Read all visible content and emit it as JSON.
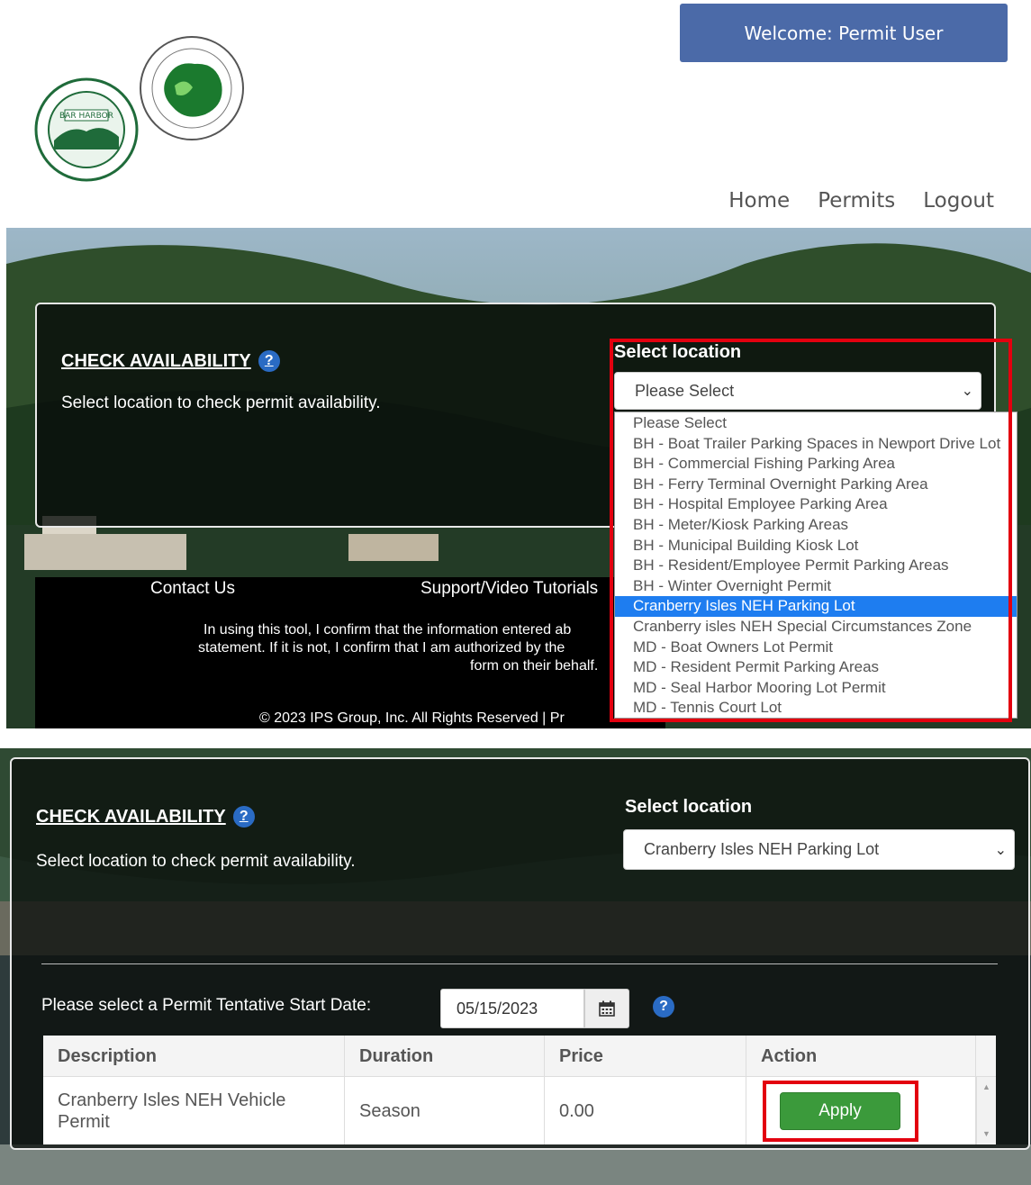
{
  "header": {
    "welcome": "Welcome:  Permit User",
    "nav": [
      "Home",
      "Permits",
      "Logout"
    ]
  },
  "seals": {
    "bar_harbor": "BAR HARBOR seal",
    "mount_desert": "TOWN OF MOUNT DESERT seal"
  },
  "check": {
    "title": "CHECK AVAILABILITY",
    "help": "?",
    "subtitle": "Select location to check permit availability.",
    "location_label": "Select location"
  },
  "dropdown": {
    "current": "Please Select",
    "options": [
      "Please Select",
      "BH - Boat Trailer Parking Spaces in Newport Drive Lot",
      "BH - Commercial Fishing Parking Area",
      "BH - Ferry Terminal Overnight Parking Area",
      "BH - Hospital Employee Parking Area",
      "BH - Meter/Kiosk Parking Areas",
      "BH - Municipal Building Kiosk Lot",
      "BH - Resident/Employee Permit Parking Areas",
      "BH - Winter Overnight Permit",
      "Cranberry Isles NEH Parking Lot",
      "Cranberry isles NEH Special Circumstances Zone",
      "MD - Boat Owners Lot Permit",
      "MD - Resident Permit Parking Areas",
      "MD - Seal Harbor Mooring Lot Permit",
      "MD - Tennis Court Lot"
    ],
    "highlighted": "Cranberry Isles NEH Parking Lot"
  },
  "footer": {
    "contact": "Contact Us",
    "support": "Support/Video Tutorials",
    "disclaimer_line1": "In using this tool, I confirm that the information entered ab",
    "disclaimer_line2": "statement. If it is not, I confirm that I am authorized by the",
    "disclaimer_line3": "form on their behalf.",
    "copyright": "© 2023 IPS Group, Inc. All Rights Reserved  |  Pr"
  },
  "second": {
    "selected_location": "Cranberry Isles NEH Parking Lot",
    "date_label": "Please select a Permit Tentative Start Date:",
    "date_value": "05/15/2023",
    "table": {
      "headers": [
        "Description",
        "Duration",
        "Price",
        "Action"
      ],
      "rows": [
        {
          "description_1": "Cranberry Isles NEH Vehicle",
          "description_2": "Permit",
          "duration": "Season",
          "price": "0.00",
          "action": "Apply"
        }
      ]
    }
  },
  "colors": {
    "welcome_bg": "#4b6aa8",
    "highlight": "#1e7df0",
    "apply": "#3b9a3b",
    "annotation": "#e3000f"
  }
}
